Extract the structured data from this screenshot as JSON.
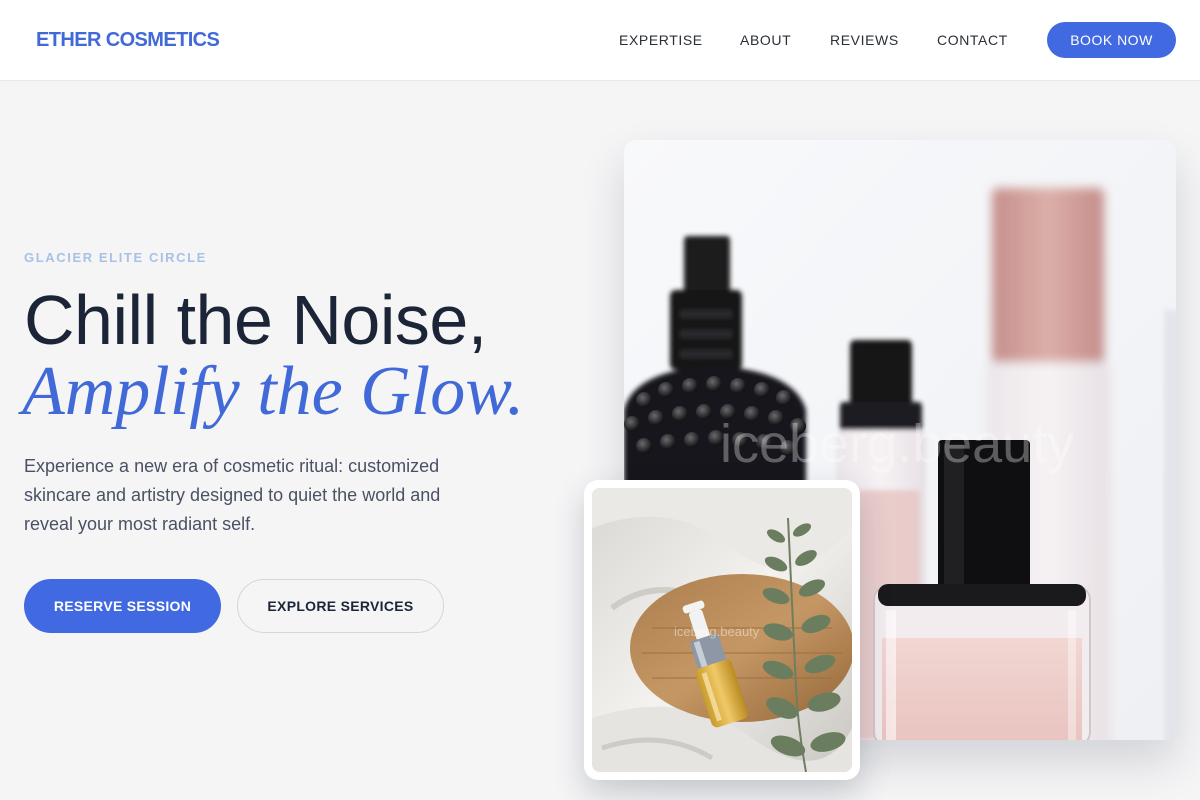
{
  "header": {
    "brand": "ETHER COSMETICS",
    "nav": [
      {
        "label": "EXPERTISE"
      },
      {
        "label": "ABOUT"
      },
      {
        "label": "REVIEWS"
      },
      {
        "label": "CONTACT"
      }
    ],
    "cta_label": "BOOK NOW"
  },
  "hero": {
    "eyebrow": "GLACIER ELITE CIRCLE",
    "headline_line1": "Chill the Noise,",
    "headline_line2": "Amplify the Glow.",
    "description": "Experience a new era of cosmetic ritual: customized skincare and artistry designed to quiet the world and reveal your most radiant self.",
    "primary_button": "RESERVE SESSION",
    "secondary_button": "EXPLORE SERVICES"
  },
  "images": {
    "main_watermark": "iceberg.beauty",
    "inset_watermark": "iceberg.beauty"
  },
  "colors": {
    "accent": "#4169e1",
    "brand": "#4169d8",
    "eyebrow": "#a9c1e6",
    "text_dark": "#1b2537",
    "background": "#f5f5f6"
  }
}
